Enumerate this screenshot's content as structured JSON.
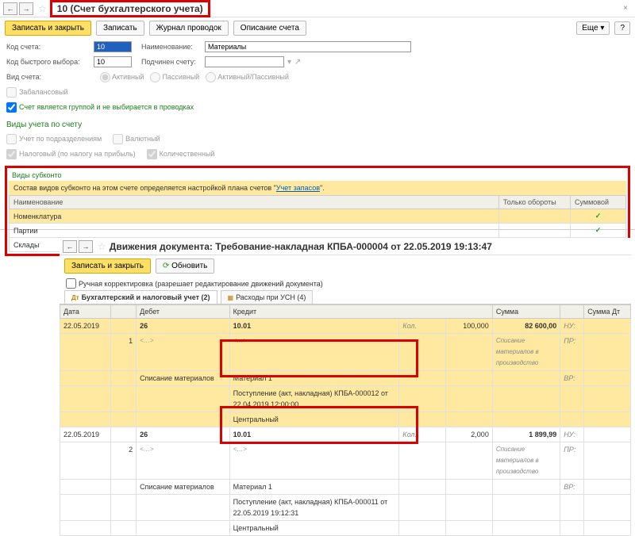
{
  "top": {
    "title": "10 (Счет бухгалтерского учета)",
    "btn_save_close": "Записать и закрыть",
    "btn_save": "Записать",
    "btn_journal": "Журнал проводок",
    "btn_desc": "Описание счета",
    "btn_more": "Еще",
    "fields": {
      "code_label": "Код счета:",
      "code_value": "10",
      "name_label": "Наименование:",
      "name_value": "Материалы",
      "quick_label": "Код быстрого выбора:",
      "quick_value": "10",
      "parent_label": "Подчинен счету:",
      "kind_label": "Вид счета:",
      "r_active": "Активный",
      "r_passive": "Пассивный",
      "r_ap": "Активный/Пассивный",
      "cb_offbal": "Забалансовый",
      "cb_group": "Счет является группой и не выбирается в проводках"
    },
    "acct_section": {
      "title": "Виды учета по счету",
      "cb_dept": "Учет по подразделениям",
      "cb_curr": "Валютный",
      "cb_tax": "Налоговый (по налогу на прибыль)",
      "cb_qty": "Количественный"
    },
    "subk": {
      "title": "Виды субконто",
      "hint_prefix": "Состав видов субконто на этом счете определяется настройкой плана счетов \"",
      "hint_link": "Учет запасов",
      "hint_suffix": "\".",
      "col_name": "Наименование",
      "col_only": "Только обороты",
      "col_sum": "Суммовой",
      "rows": [
        "Номенклатура",
        "Партии",
        "Склады"
      ]
    }
  },
  "bot": {
    "title": "Движения документа: Требование-накладная КПБА-000004 от 22.05.2019 19:13:47",
    "btn_save_close": "Записать и закрыть",
    "btn_refresh": "Обновить",
    "cb_manual": "Ручная корректировка (разрешает редактирование движений документа)",
    "tab1": "Бухгалтерский и налоговый учет (2)",
    "tab2": "Расходы при УСН (4)",
    "cols": {
      "date": "Дата",
      "debit": "Дебет",
      "credit": "Кредит",
      "sum": "Сумма",
      "sum_dt": "Сумма Дт"
    },
    "rows": [
      {
        "date": "22.05.2019",
        "n": "1",
        "dt": "26",
        "kt": "10.01",
        "kol": "Кол.",
        "qty": "100,000",
        "sum": "82 600,00",
        "nu": "НУ:",
        "pr": "ПР:",
        "vr": "ВР:",
        "comment": "Списание материалов в производство",
        "dt_desc": "Списание материалов",
        "mat": "Материал 1",
        "doc": "Поступление (акт, накладная) КПБА-000012 от 22.04.2019 12:00:00",
        "wh": "Центральный"
      },
      {
        "date": "22.05.2019",
        "n": "2",
        "dt": "26",
        "kt": "10.01",
        "kol": "Кол.",
        "qty": "2,000",
        "sum": "1 899,99",
        "nu": "НУ:",
        "pr": "ПР:",
        "vr": "ВР:",
        "comment": "Списание материалов в производство",
        "dt_desc": "Списание материалов",
        "mat": "Материал 1",
        "doc": "Поступление (акт, накладная) КПБА-000011 от 22.05.2019 19:12:31",
        "wh": "Центральный"
      }
    ]
  }
}
